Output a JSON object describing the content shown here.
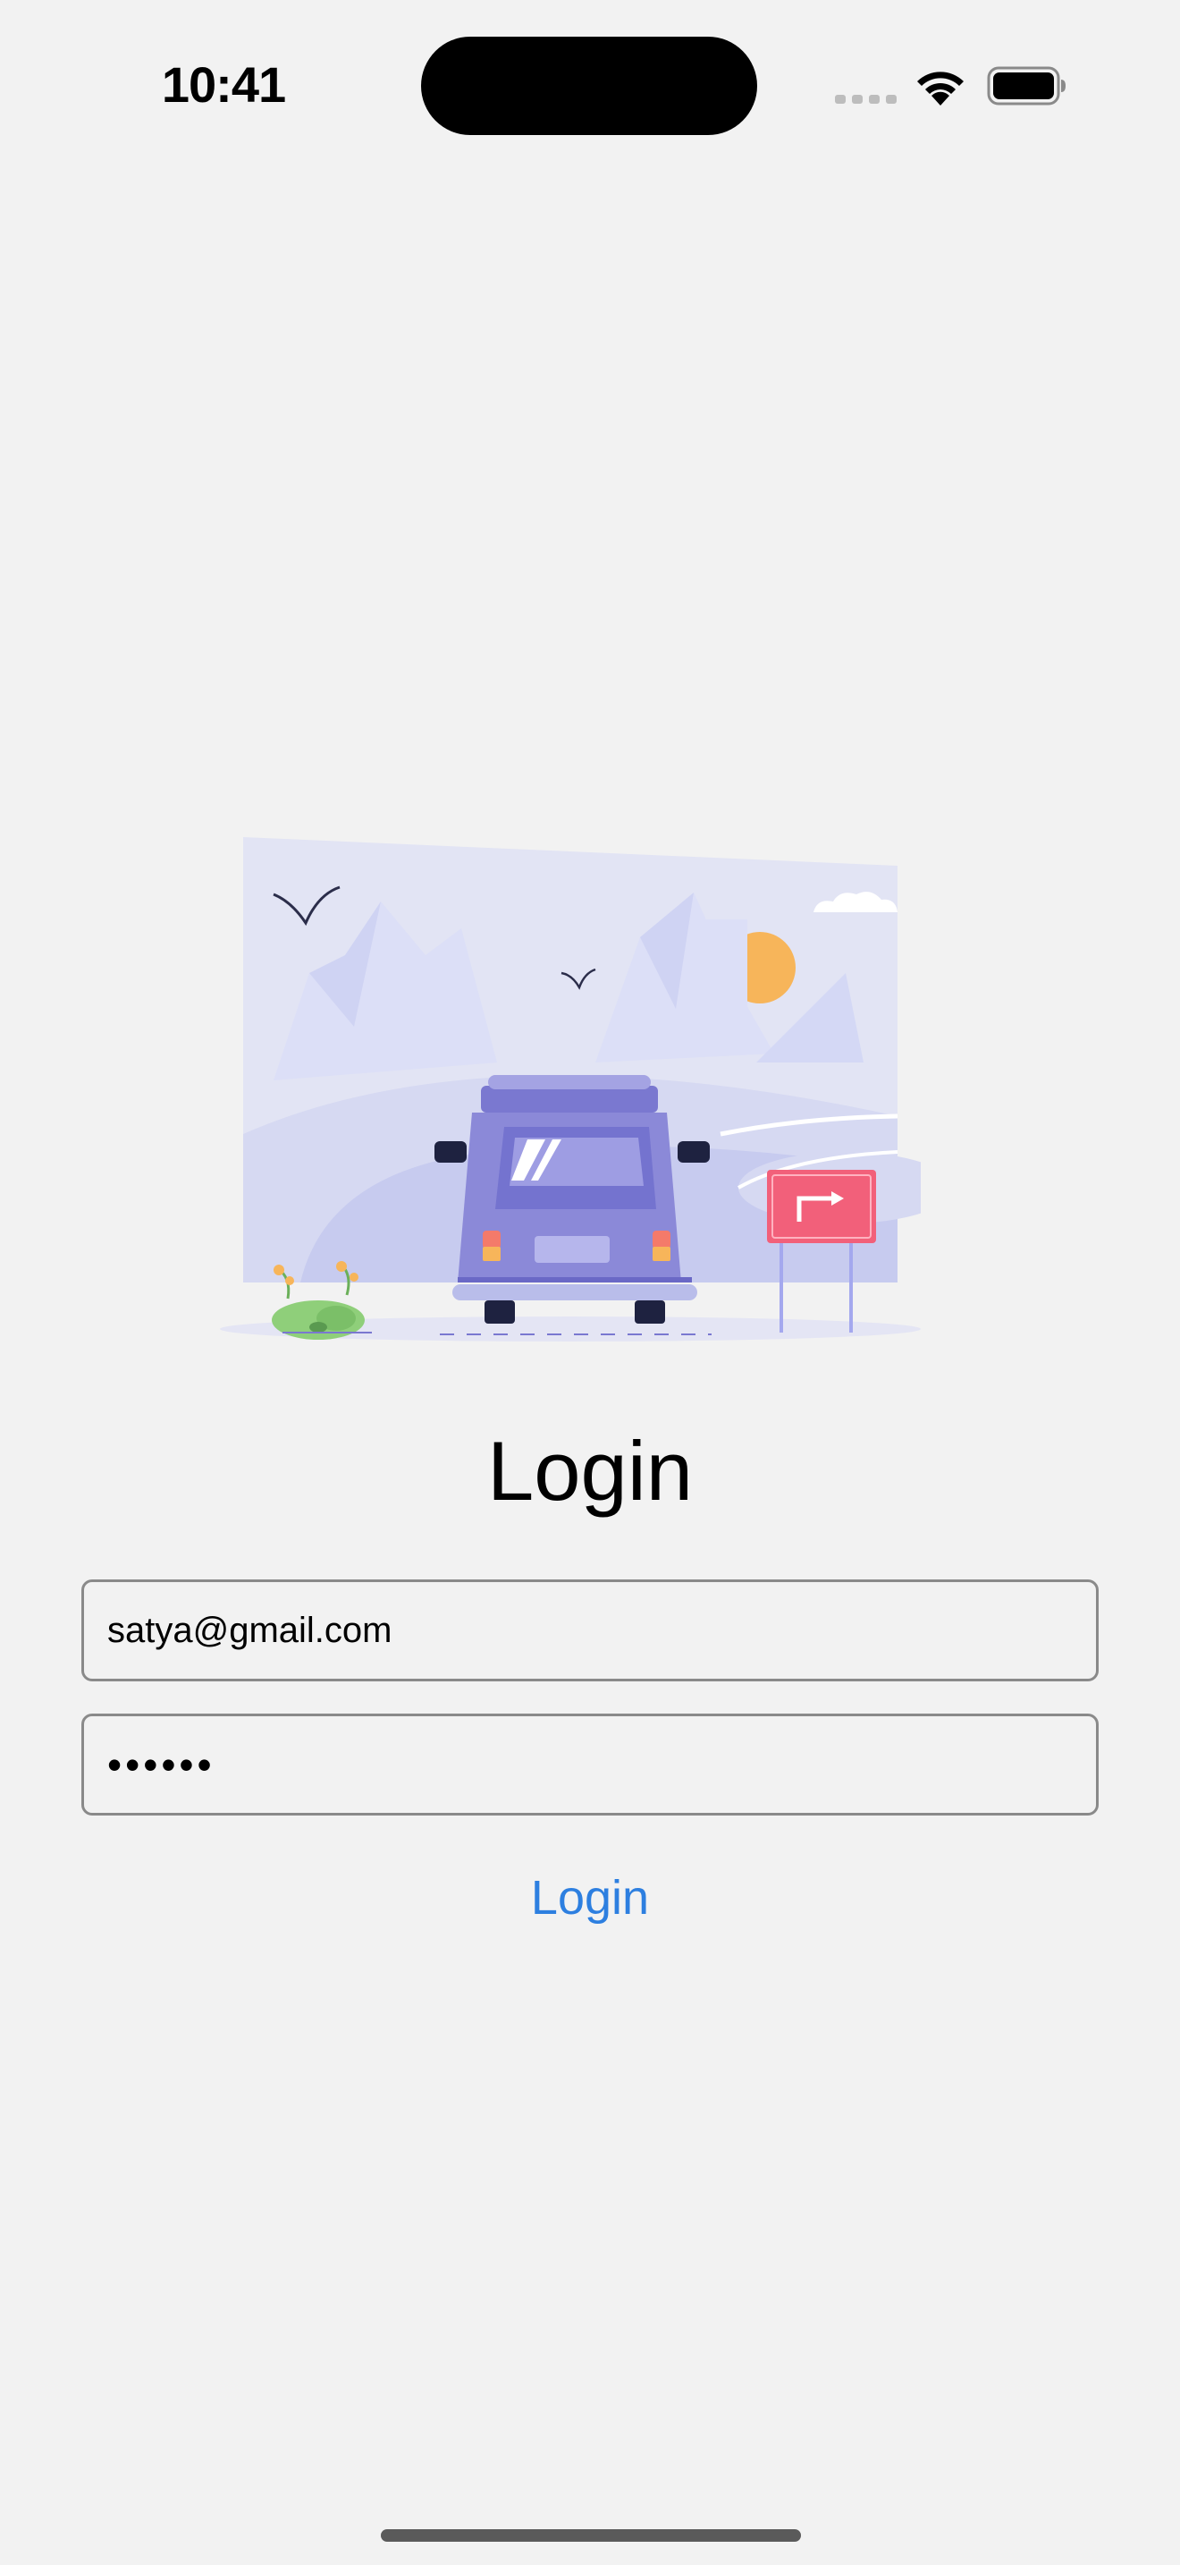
{
  "status_bar": {
    "time": "10:41"
  },
  "login": {
    "title": "Login",
    "email_value": "satya@gmail.com",
    "password_value": "••••••",
    "submit_label": "Login"
  },
  "colors": {
    "background": "#f2f2f2",
    "link": "#2d7fe0",
    "field_border": "#8a8a8a",
    "van": "#8b89d8",
    "sign": "#f2607a",
    "sun": "#f7b55a"
  },
  "icons": {
    "signal": "cellular-signal-icon",
    "wifi": "wifi-icon",
    "battery": "battery-icon",
    "illustration": "van-on-road-illustration"
  }
}
